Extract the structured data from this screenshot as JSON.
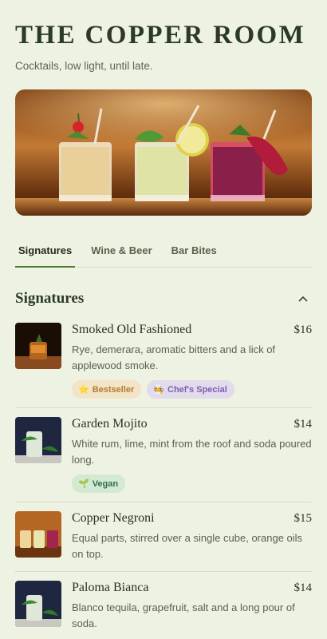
{
  "brand": {
    "title": "THE COPPER ROOM",
    "tagline": "Cocktails, low light, until late."
  },
  "tabs": [
    {
      "label": "Signatures",
      "active": true
    },
    {
      "label": "Wine & Beer",
      "active": false
    },
    {
      "label": "Bar Bites",
      "active": false
    }
  ],
  "section": {
    "title": "Signatures",
    "icon": "chevron-up-icon"
  },
  "items": [
    {
      "name": "Smoked Old Fashioned",
      "price": "$16",
      "desc": "Rye, demerara, aromatic bitters and a lick of applewood smoke.",
      "badges": [
        {
          "label": "Bestseller",
          "icon": "star-icon"
        },
        {
          "label": "Chef's Special",
          "icon": "chef-icon"
        }
      ]
    },
    {
      "name": "Garden Mojito",
      "price": "$14",
      "desc": "White rum, lime, mint from the roof and soda poured long.",
      "badges": [
        {
          "label": "Vegan",
          "icon": "sprout-icon"
        }
      ]
    },
    {
      "name": "Copper Negroni",
      "price": "$15",
      "desc": "Equal parts, stirred over a single cube, orange oils on top."
    },
    {
      "name": "Paloma Bianca",
      "price": "$14",
      "desc": "Blanco tequila, grapefruit, salt and a long pour of soda."
    }
  ],
  "colors": {
    "background": "#eef2e2",
    "accent": "#4f7a34",
    "text": "#2b3a24"
  }
}
